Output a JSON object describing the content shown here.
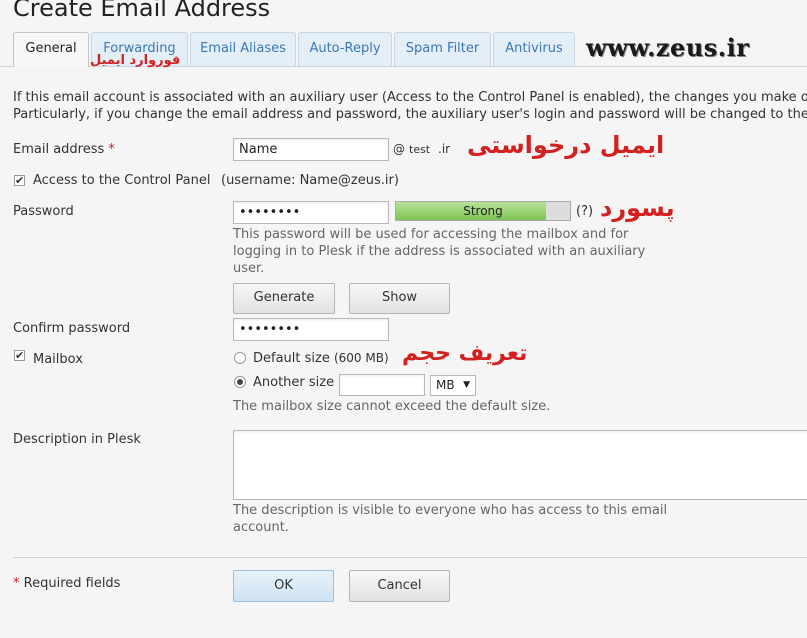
{
  "page": {
    "title": "Create Email Address"
  },
  "tabs": [
    {
      "label": "General"
    },
    {
      "label": "Forwarding"
    },
    {
      "label": "Email Aliases"
    },
    {
      "label": "Auto-Reply"
    },
    {
      "label": "Spam Filter"
    },
    {
      "label": "Antivirus"
    }
  ],
  "overlays": {
    "forwarding_ar": "فوروارد ایمیل",
    "watermark": "www.zeus.ir",
    "email_ar": "ایمیل درخواستی",
    "password_ar": "پسورد",
    "size_ar": "تعریف حجم"
  },
  "intro": {
    "line1": "If this email account is associated with an auxiliary user (Access to the Control Panel is enabled), the changes you make o",
    "line2": "Particularly, if you change the email address and password, the auxiliary user's login and password will be changed to the"
  },
  "form": {
    "email_label": "Email address",
    "required_mark": "*",
    "email_value": "Name",
    "at_sign": "@",
    "domain_name": "test",
    "domain_tld": ".ir",
    "cp_access_label": "Access to the Control Panel",
    "cp_access_checked": true,
    "cp_username": "(username: Name@zeus.ir)",
    "password_label": "Password",
    "password_value": "••••••••",
    "strength_label": "Strong",
    "strength_level": 0.86,
    "help_mark": "(?)",
    "password_hint_1": "This password will be used for accessing the mailbox and for",
    "password_hint_2": "logging in to Plesk if the address is associated with an auxiliary",
    "password_hint_3": "user.",
    "generate_label": "Generate",
    "show_label": "Show",
    "confirm_label": "Confirm password",
    "confirm_value": "••••••••",
    "mailbox_label": "Mailbox",
    "mailbox_checked": true,
    "default_size_label": "Default size",
    "default_size_value": "(600 MB)",
    "another_size_label": "Another size",
    "another_size_value": "",
    "unit_selected": "MB",
    "size_hint": "The mailbox size cannot exceed the default size.",
    "description_label": "Description in Plesk",
    "description_value": "",
    "description_hint_1": "The description is visible to everyone who has access to this email",
    "description_hint_2": "account.",
    "required_note": "Required fields",
    "ok_label": "OK",
    "cancel_label": "Cancel"
  },
  "colors": {
    "accent_red": "#d32020",
    "tab_link": "#3a78b0",
    "meter_green": "#7fc254"
  }
}
